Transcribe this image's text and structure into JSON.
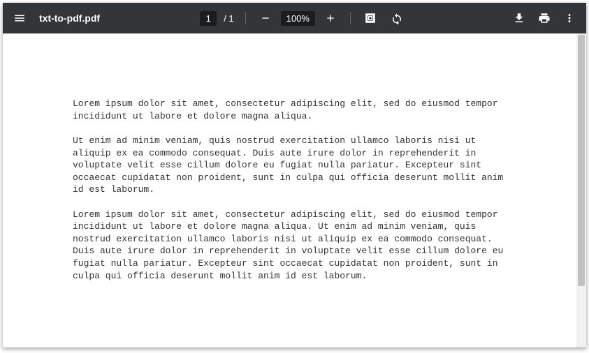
{
  "toolbar": {
    "filename": "txt-to-pdf.pdf",
    "page_current": "1",
    "page_total": "/ 1",
    "zoom_level": "100%"
  },
  "document": {
    "paragraphs": [
      "Lorem ipsum dolor sit amet, consectetur adipiscing elit, sed do eiusmod tempor incididunt ut labore et dolore magna aliqua.",
      "Ut enim ad minim veniam, quis nostrud exercitation ullamco laboris nisi ut aliquip ex ea commodo consequat. Duis aute irure dolor in reprehenderit in voluptate velit esse cillum dolore eu fugiat nulla pariatur. Excepteur sint occaecat cupidatat non proident, sunt in culpa qui officia deserunt mollit anim id est laborum.",
      "Lorem ipsum dolor sit amet, consectetur adipiscing elit, sed do eiusmod tempor incididunt ut labore et dolore magna aliqua. Ut enim ad minim veniam, quis nostrud exercitation ullamco laboris nisi ut aliquip ex ea commodo consequat. Duis aute irure dolor in reprehenderit in voluptate velit esse cillum dolore eu fugiat nulla pariatur. Excepteur sint occaecat cupidatat non proident, sunt in culpa qui officia deserunt mollit anim id est laborum."
    ]
  }
}
